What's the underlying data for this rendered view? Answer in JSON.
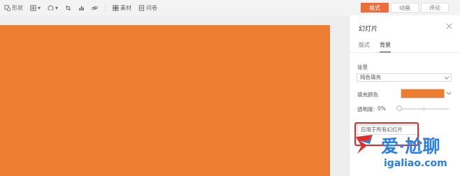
{
  "toolbar": {
    "items": [
      {
        "label": "形状",
        "icon": "shapes-icon"
      },
      {
        "label": "",
        "icon": "table-icon"
      },
      {
        "label": "",
        "icon": "symbol-icon"
      },
      {
        "label": "",
        "icon": "crop-icon"
      },
      {
        "label": "",
        "icon": "chart-icon"
      },
      {
        "label": "",
        "icon": "link-icon"
      },
      {
        "label": "素材",
        "icon": "assets-icon"
      },
      {
        "label": "问卷",
        "icon": "survey-icon"
      }
    ]
  },
  "top_tabs": [
    {
      "label": "格式",
      "active": true
    },
    {
      "label": "动画",
      "active": false
    },
    {
      "label": "评论",
      "active": false
    }
  ],
  "panel": {
    "title": "幻灯片",
    "subtabs": [
      {
        "label": "版式",
        "active": false
      },
      {
        "label": "背景",
        "active": true
      }
    ],
    "background_label": "背景",
    "fill_type": "纯色填充",
    "fill_color_label": "填充颜色",
    "fill_color": "#ed7d31",
    "transparency_label": "透明度:",
    "transparency_value": "0%",
    "apply_all_label": "应用于所有幻灯片"
  },
  "watermark": {
    "text": "爱·尬聊",
    "url": "igaliao.com"
  },
  "colors": {
    "accent": "#ec6e3a",
    "slide_fill": "#ed7d31",
    "highlight": "#e02b2b",
    "watermark": "#2b7fe0"
  }
}
